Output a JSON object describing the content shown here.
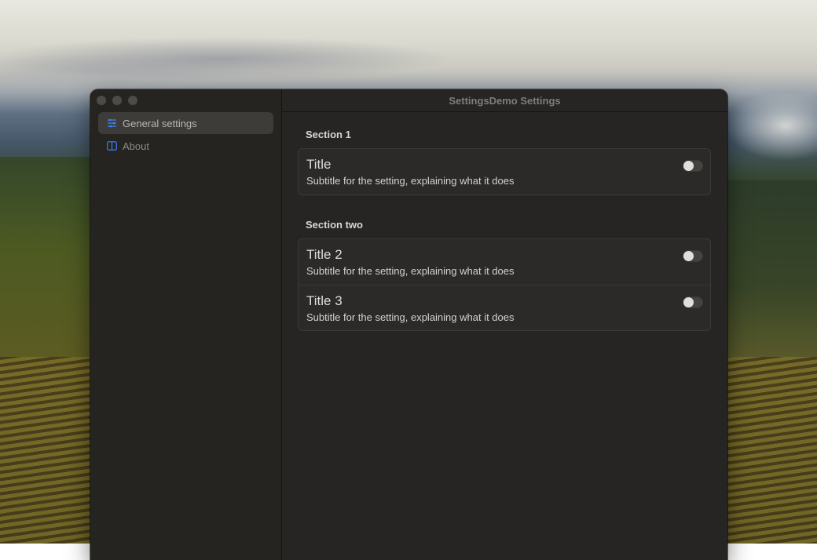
{
  "window": {
    "title": "SettingsDemo Settings"
  },
  "sidebar": {
    "items": [
      {
        "label": "General settings",
        "icon": "sliders-icon",
        "selected": true
      },
      {
        "label": "About",
        "icon": "info-panel-icon",
        "selected": false
      }
    ]
  },
  "sections": [
    {
      "header": "Section 1",
      "rows": [
        {
          "title": "Title",
          "subtitle": "Subtitle for the setting, explaining what it does",
          "enabled": false
        }
      ]
    },
    {
      "header": "Section two",
      "rows": [
        {
          "title": "Title 2",
          "subtitle": "Subtitle for the setting, explaining what it does",
          "enabled": false
        },
        {
          "title": "Title 3",
          "subtitle": "Subtitle for the setting, explaining what it does",
          "enabled": false
        }
      ]
    }
  ],
  "colors": {
    "accent": "#3a82f7",
    "window_bg": "#262523",
    "card_bg": "#2b2a28"
  }
}
